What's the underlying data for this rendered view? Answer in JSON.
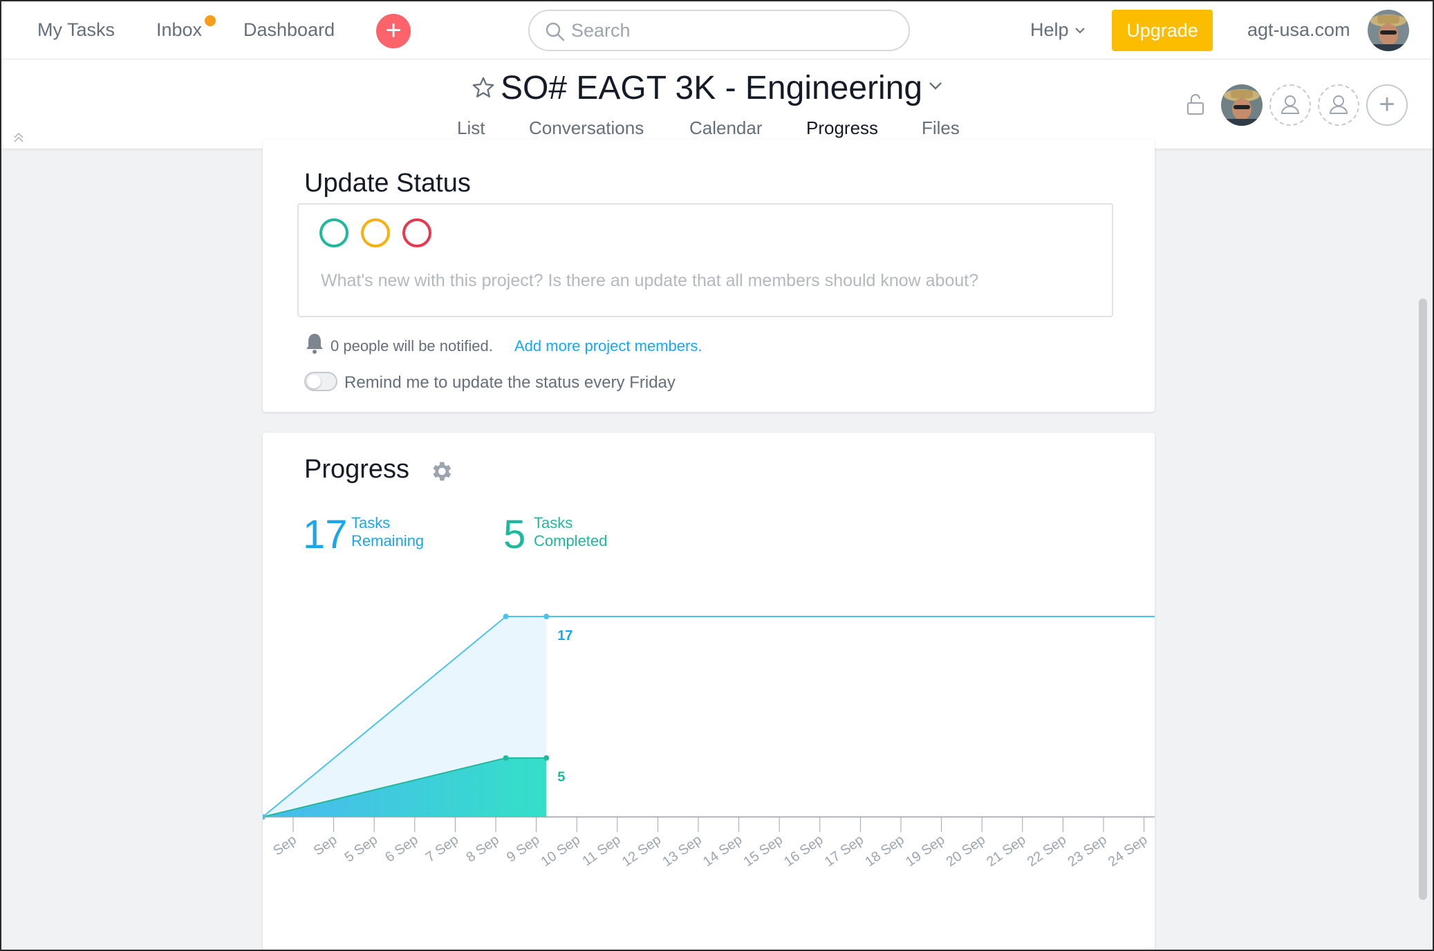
{
  "topbar": {
    "my_tasks": "My Tasks",
    "inbox": "Inbox",
    "dashboard": "Dashboard",
    "add_symbol": "+",
    "search_placeholder": "Search",
    "help": "Help",
    "upgrade": "Upgrade",
    "org": "agt-usa.com"
  },
  "project": {
    "title": "SO# EAGT 3K - Engineering",
    "tabs": [
      "List",
      "Conversations",
      "Calendar",
      "Progress",
      "Files"
    ],
    "active_tab": "Progress",
    "add_member_symbol": "+"
  },
  "update_status": {
    "heading": "Update Status",
    "status_colors": [
      "#1fb89a",
      "#f8b00f",
      "#e8384f"
    ],
    "placeholder": "What's new with this project? Is there an update that all members should know about?",
    "notify_text": "0 people will be notified.",
    "add_members_link": "Add more project members.",
    "remind_text": "Remind me to update the status every Friday",
    "remind_enabled": false
  },
  "progress": {
    "heading": "Progress",
    "remaining_count": "17",
    "remaining_label_1": "Tasks",
    "remaining_label_2": "Remaining",
    "completed_count": "5",
    "completed_label_1": "Tasks",
    "completed_label_2": "Completed"
  },
  "chart_data": {
    "type": "area",
    "x": [
      "Sep",
      "Sep",
      "5 Sep",
      "6 Sep",
      "7 Sep",
      "8 Sep",
      "9 Sep",
      "10 Sep",
      "11 Sep",
      "12 Sep",
      "13 Sep",
      "14 Sep",
      "15 Sep",
      "16 Sep",
      "17 Sep",
      "18 Sep",
      "19 Sep",
      "20 Sep",
      "21 Sep",
      "22 Sep",
      "23 Sep",
      "24 Sep"
    ],
    "series": [
      {
        "values": [
          0,
          null,
          null,
          null,
          null,
          null,
          null,
          17,
          17,
          17,
          17,
          17,
          17,
          17,
          17,
          17,
          17,
          17,
          17,
          17,
          17,
          17
        ],
        "color": "#4cc3ee"
      },
      {
        "values": [
          0,
          null,
          null,
          null,
          null,
          null,
          null,
          5,
          5
        ],
        "color": "#2bd7c4"
      }
    ],
    "end_labels": [
      "17",
      "5"
    ],
    "ylim": [
      0,
      17
    ]
  }
}
